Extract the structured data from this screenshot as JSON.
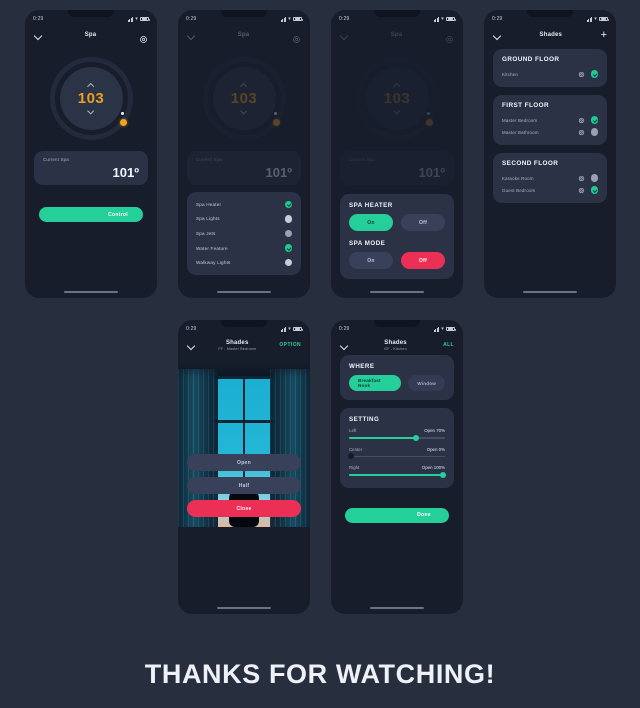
{
  "page": {
    "background": "#272e3e",
    "footer_text": "THANKS FOR WATCHING!"
  },
  "colors": {
    "green": "#25cf9a",
    "red": "#ec2f55",
    "amber": "#e8a020",
    "card": "#2b3246",
    "phone_bg": "#171d2b"
  },
  "status_bar": {
    "time": "0:29",
    "signal_icon": "signal-bars-icon",
    "wifi_icon": "wifi-icon",
    "battery_icon": "battery-icon"
  },
  "screens": [
    {
      "id": "spa-main",
      "nav": {
        "back_icon": "chevron-down-icon",
        "title": "Spa",
        "subtitle": "",
        "right_icon": "gear-icon",
        "right_label": ""
      },
      "dial": {
        "value": "103",
        "up_icon": "chevron-up-icon",
        "down_icon": "chevron-down-icon",
        "handle": "dial-handle"
      },
      "current": {
        "label": "Current Spa",
        "value": "101º"
      },
      "primary_button": "Control"
    },
    {
      "id": "spa-devices",
      "nav": {
        "back_icon": "chevron-down-icon",
        "title": "Spa",
        "right_icon": "gear-icon"
      },
      "dial": {
        "value": "103"
      },
      "current": {
        "label": "Current Spa",
        "value": "101º"
      },
      "devices": [
        {
          "label": "Spa Heater",
          "state": "on"
        },
        {
          "label": "Spa Lights",
          "state": "off"
        },
        {
          "label": "Spa Jets",
          "state": "off"
        },
        {
          "label": "Water Feature",
          "state": "on"
        },
        {
          "label": "Walkway Lights",
          "state": "off"
        }
      ]
    },
    {
      "id": "spa-modes",
      "nav": {
        "back_icon": "chevron-down-icon",
        "title": "Spa",
        "right_icon": "gear-icon"
      },
      "dial": {
        "value": "103"
      },
      "current": {
        "label": "Current Spa",
        "value": "101º"
      },
      "groups": [
        {
          "title": "SPA HEATER",
          "options": [
            {
              "label": "On",
              "state": "selected-green"
            },
            {
              "label": "Off",
              "state": "unselected"
            }
          ]
        },
        {
          "title": "SPA MODE",
          "options": [
            {
              "label": "On",
              "state": "unselected"
            },
            {
              "label": "Off",
              "state": "selected-red"
            }
          ]
        }
      ]
    },
    {
      "id": "shades-floors",
      "nav": {
        "back_icon": "chevron-down-icon",
        "title": "Shades",
        "right_icon": "plus-icon"
      },
      "floors": [
        {
          "title": "GROUND FLOOR",
          "rooms": [
            {
              "label": "Kitchen",
              "gear_icon": "gear-icon",
              "state": "on"
            }
          ]
        },
        {
          "title": "FIRST FLOOR",
          "rooms": [
            {
              "label": "Master Bedroom",
              "gear_icon": "gear-icon",
              "state": "on"
            },
            {
              "label": "Master Bathroom",
              "gear_icon": "gear-icon",
              "state": "off"
            }
          ]
        },
        {
          "title": "SECOND FLOOR",
          "rooms": [
            {
              "label": "Karaoke Room",
              "gear_icon": "gear-icon",
              "state": "off"
            },
            {
              "label": "Guest Bedroom",
              "gear_icon": "gear-icon",
              "state": "on"
            }
          ]
        }
      ]
    },
    {
      "id": "shades-detail",
      "nav": {
        "back_icon": "chevron-down-icon",
        "title": "Shades",
        "subtitle": "FF - Master Bedroom",
        "right_label": "OPTION"
      },
      "photo": "window-curtains-silhouette-photo",
      "buttons": [
        {
          "label": "Open",
          "style": "grey"
        },
        {
          "label": "Half",
          "style": "grey"
        },
        {
          "label": "Close",
          "style": "red"
        }
      ]
    },
    {
      "id": "shades-setting",
      "nav": {
        "back_icon": "chevron-down-icon",
        "title": "Shades",
        "subtitle": "GF - Kitchen",
        "right_label": "ALL"
      },
      "where": {
        "title": "WHERE",
        "chips": [
          {
            "label": "Breakfast Nook",
            "state": "on"
          },
          {
            "label": "Window",
            "state": "off"
          }
        ]
      },
      "setting": {
        "title": "SETTING",
        "sliders": [
          {
            "label": "Left",
            "value_label": "Open 70%",
            "percent": 70
          },
          {
            "label": "Center",
            "value_label": "Open 0%",
            "percent": 0
          },
          {
            "label": "Right",
            "value_label": "Open 100%",
            "percent": 100
          }
        ]
      },
      "primary_button": "Done"
    }
  ]
}
